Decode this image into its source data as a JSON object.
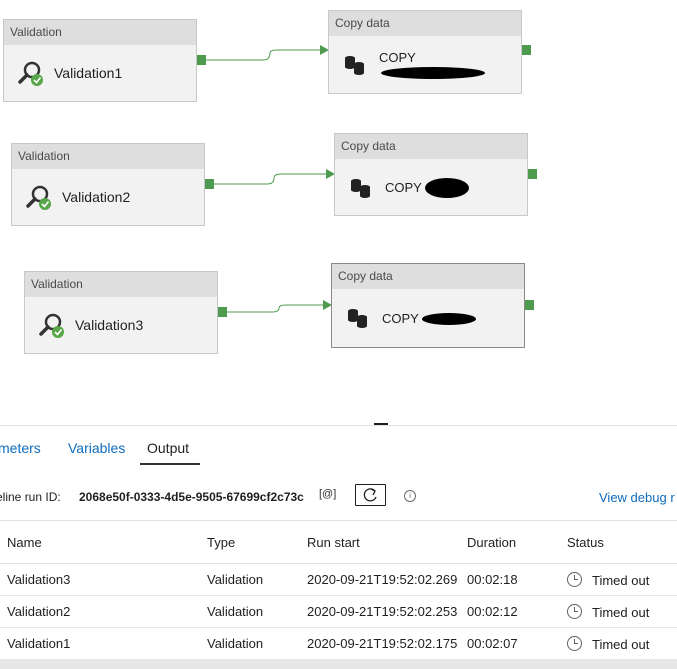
{
  "pipeline": {
    "validations": [
      {
        "header": "Validation",
        "name": "Validation1"
      },
      {
        "header": "Validation",
        "name": "Validation2"
      },
      {
        "header": "Validation",
        "name": "Validation3"
      }
    ],
    "copies": [
      {
        "header": "Copy data",
        "name": "COPY"
      },
      {
        "header": "Copy data",
        "name": "COPY"
      },
      {
        "header": "Copy data",
        "name": "COPY"
      }
    ]
  },
  "tabs": {
    "parameters": "meters",
    "variables": "Variables",
    "output": "Output"
  },
  "run": {
    "label": "eline run ID:",
    "id": "2068e50f-0333-4d5e-9505-67699cf2c73c",
    "copy_icon": "copy-id-icon",
    "view_debug": "View debug r"
  },
  "table": {
    "headers": [
      "Name",
      "Type",
      "Run start",
      "Duration",
      "Status"
    ],
    "rows": [
      {
        "name": "Validation3",
        "type": "Validation",
        "run_start": "2020-09-21T19:52:02.269",
        "duration": "00:02:18",
        "status": "Timed out"
      },
      {
        "name": "Validation2",
        "type": "Validation",
        "run_start": "2020-09-21T19:52:02.253",
        "duration": "00:02:12",
        "status": "Timed out"
      },
      {
        "name": "Validation1",
        "type": "Validation",
        "run_start": "2020-09-21T19:52:02.175",
        "duration": "00:02:07",
        "status": "Timed out"
      }
    ]
  },
  "colors": {
    "link": "#0f6cbd",
    "connector": "#4e9a4e",
    "success_badge": "#57a64a"
  }
}
